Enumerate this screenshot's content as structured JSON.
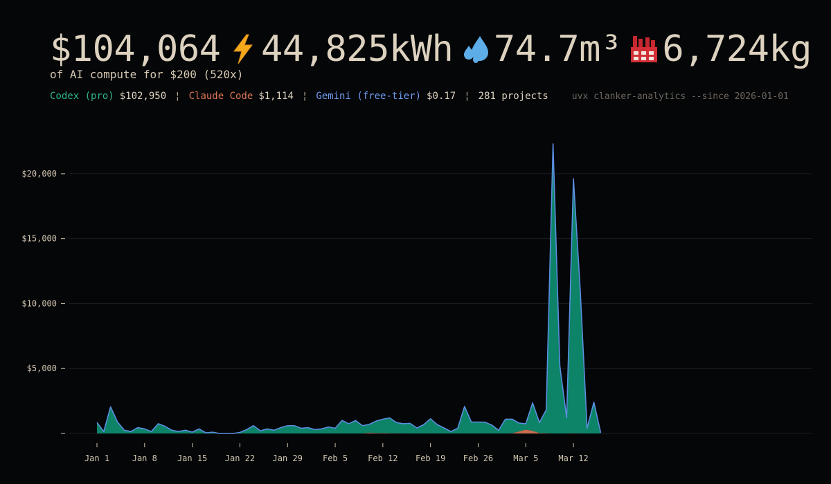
{
  "header": {
    "total_cost": "$104,064",
    "energy": "44,825kWh",
    "water": "74.7m³",
    "emissions": "6,724kg",
    "subtitle": "of AI compute for $200 (520x)",
    "icons": [
      "lightning-icon",
      "water-drops-icon",
      "factory-icon"
    ]
  },
  "stats": {
    "codex_label": "Codex (pro)",
    "codex_value": "$102,950",
    "claude_label": "Claude Code",
    "claude_value": "$1,114",
    "gemini_label": "Gemini (free-tier)",
    "gemini_value": "$0.17",
    "separator": "¦",
    "projects": "281 projects",
    "command": "uvx clanker-analytics --since 2026-01-01"
  },
  "colors": {
    "codex": "#2fb58a",
    "codex_fill": "#0e8a6e",
    "claude": "#e07857",
    "gemini": "#5b8fe0",
    "background": "#050608",
    "text": "#d8ccb8"
  },
  "chart_data": {
    "type": "area",
    "ylim": [
      0,
      22500
    ],
    "y_ticks": [
      0,
      5000,
      10000,
      15000,
      20000
    ],
    "y_tick_labels": [
      "",
      "$5,000",
      "$10,000",
      "$15,000",
      "$20,000"
    ],
    "x_tick_labels": [
      "Jan 1",
      "Jan 8",
      "Jan 15",
      "Jan 22",
      "Jan 29",
      "Feb 5",
      "Feb 12",
      "Feb 19",
      "Feb 26",
      "Mar 5",
      "Mar 12"
    ],
    "x_tick_days": [
      0,
      7,
      14,
      21,
      28,
      35,
      42,
      49,
      56,
      63,
      70
    ],
    "grid": true,
    "stacked": true,
    "series": [
      {
        "name": "Claude Code",
        "color": "#e07857",
        "values": [
          0,
          0,
          0,
          0,
          0,
          0,
          0,
          0,
          0,
          0,
          0,
          0,
          0,
          0,
          0,
          0,
          0,
          0,
          0,
          0,
          0,
          0,
          0,
          0,
          0,
          0,
          0,
          0,
          0,
          0,
          0,
          0,
          0,
          0,
          0,
          0,
          0,
          0,
          0,
          0,
          60,
          40,
          30,
          20,
          10,
          10,
          0,
          0,
          0,
          0,
          0,
          0,
          0,
          0,
          0,
          0,
          0,
          0,
          0,
          0,
          0,
          20,
          150,
          300,
          200,
          40,
          20,
          0,
          0,
          0,
          20,
          0,
          0,
          0,
          0
        ]
      },
      {
        "name": "Codex (pro)",
        "color": "#0e8a6e",
        "values": [
          850,
          150,
          2050,
          900,
          250,
          150,
          450,
          350,
          150,
          750,
          550,
          250,
          150,
          250,
          100,
          350,
          50,
          100,
          0,
          0,
          0,
          80,
          300,
          600,
          200,
          350,
          250,
          450,
          600,
          600,
          400,
          450,
          300,
          350,
          500,
          400,
          1000,
          750,
          1000,
          600,
          640,
          910,
          1070,
          1180,
          830,
          740,
          780,
          420,
          680,
          1130,
          680,
          420,
          150,
          400,
          2080,
          880,
          880,
          870,
          650,
          240,
          1100,
          1080,
          650,
          450,
          2150,
          800,
          1800,
          22300,
          5200,
          1200,
          19600,
          11000,
          400,
          2400,
          60
        ]
      },
      {
        "name": "Gemini (free-tier)",
        "color": "#5b8fe0",
        "values": [
          0,
          0,
          0,
          0,
          0,
          0,
          0,
          0,
          0,
          0,
          0,
          0,
          0,
          0,
          0,
          0,
          0,
          0,
          0,
          0,
          0,
          0,
          0,
          0,
          0,
          0,
          0,
          0,
          0,
          0,
          0,
          0,
          0,
          0,
          0,
          0,
          0,
          0,
          0,
          0,
          0,
          0,
          0,
          0,
          0,
          0,
          0,
          0,
          0,
          0,
          0,
          0,
          0,
          0,
          0,
          0,
          0,
          0,
          0,
          0,
          0,
          0,
          0,
          0,
          0,
          0,
          0,
          0,
          0,
          0,
          0,
          0,
          0,
          0,
          0.17
        ]
      }
    ]
  }
}
